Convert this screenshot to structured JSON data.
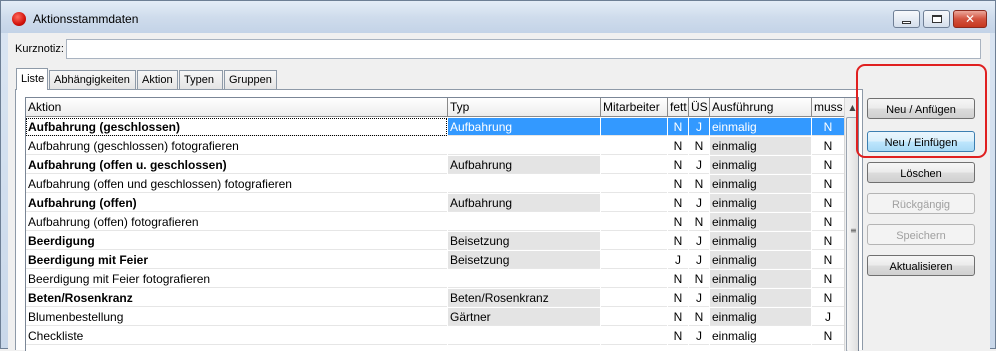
{
  "window": {
    "title": "Aktionsstammdaten"
  },
  "kurznotiz": {
    "label": "Kurznotiz:",
    "value": ""
  },
  "tabs": [
    "Liste",
    "Abhängigkeiten",
    "Aktion",
    "Typen",
    "Gruppen"
  ],
  "columns": {
    "aktion": "Aktion",
    "typ": "Typ",
    "mitarbeiter": "Mitarbeiter",
    "fett": "fett",
    "us": "ÜS",
    "ausfuehrung": "Ausführung",
    "muss": "muss"
  },
  "rows": [
    {
      "aktion": "Aufbahrung (geschlossen)",
      "typ": "Aufbahrung",
      "mitarbeiter": "",
      "fett": "N",
      "us": "J",
      "ausfuehrung": "einmalig",
      "muss": "N"
    },
    {
      "aktion": "Aufbahrung (geschlossen) fotografieren",
      "typ": "",
      "mitarbeiter": "",
      "fett": "N",
      "us": "N",
      "ausfuehrung": "einmalig",
      "muss": "N"
    },
    {
      "aktion": "Aufbahrung (offen u. geschlossen)",
      "typ": "Aufbahrung",
      "mitarbeiter": "",
      "fett": "N",
      "us": "J",
      "ausfuehrung": "einmalig",
      "muss": "N"
    },
    {
      "aktion": "Aufbahrung (offen und geschlossen) fotografieren",
      "typ": "",
      "mitarbeiter": "",
      "fett": "N",
      "us": "N",
      "ausfuehrung": "einmalig",
      "muss": "N"
    },
    {
      "aktion": "Aufbahrung (offen)",
      "typ": "Aufbahrung",
      "mitarbeiter": "",
      "fett": "N",
      "us": "J",
      "ausfuehrung": "einmalig",
      "muss": "N"
    },
    {
      "aktion": "Aufbahrung (offen) fotografieren",
      "typ": "",
      "mitarbeiter": "",
      "fett": "N",
      "us": "N",
      "ausfuehrung": "einmalig",
      "muss": "N"
    },
    {
      "aktion": "Beerdigung",
      "typ": "Beisetzung",
      "mitarbeiter": "",
      "fett": "N",
      "us": "J",
      "ausfuehrung": "einmalig",
      "muss": "N"
    },
    {
      "aktion": "Beerdigung mit Feier",
      "typ": "Beisetzung",
      "mitarbeiter": "",
      "fett": "J",
      "us": "J",
      "ausfuehrung": "einmalig",
      "muss": "N"
    },
    {
      "aktion": "Beerdigung mit Feier fotografieren",
      "typ": "",
      "mitarbeiter": "",
      "fett": "N",
      "us": "N",
      "ausfuehrung": "einmalig",
      "muss": "N"
    },
    {
      "aktion": "Beten/Rosenkranz",
      "typ": "Beten/Rosenkranz",
      "mitarbeiter": "",
      "fett": "N",
      "us": "J",
      "ausfuehrung": "einmalig",
      "muss": "N"
    },
    {
      "aktion": "Blumenbestellung",
      "typ": "Gärtner",
      "mitarbeiter": "",
      "fett": "N",
      "us": "N",
      "ausfuehrung": "einmalig",
      "muss": "J"
    },
    {
      "aktion": "Checkliste",
      "typ": "",
      "mitarbeiter": "",
      "fett": "N",
      "us": "J",
      "ausfuehrung": "einmalig",
      "muss": "N"
    }
  ],
  "buttons": {
    "neu_anfuegen": "Neu / Anfügen",
    "neu_einfuegen": "Neu / Einfügen",
    "loeschen": "Löschen",
    "rueckgaengig": "Rückgängig",
    "speichern": "Speichern",
    "aktualisieren": "Aktualisieren"
  },
  "colors": {
    "selection": "#3399ff",
    "highlight_border": "#e02020",
    "shaded_cell": "#e4e4e4"
  }
}
